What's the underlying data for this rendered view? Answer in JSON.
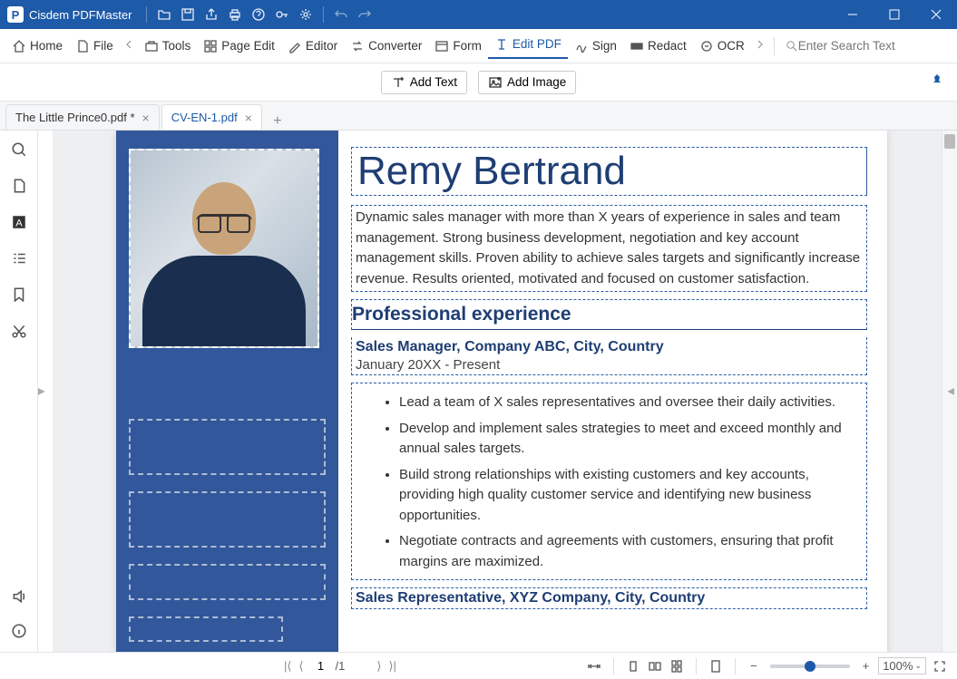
{
  "app": {
    "name": "Cisdem PDFMaster"
  },
  "mainToolbar": {
    "home": "Home",
    "file": "File",
    "tools": "Tools",
    "pageEdit": "Page Edit",
    "editor": "Editor",
    "converter": "Converter",
    "form": "Form",
    "editPdf": "Edit PDF",
    "sign": "Sign",
    "redact": "Redact",
    "ocr": "OCR",
    "searchPlaceholder": "Enter Search Text"
  },
  "editToolbar": {
    "addText": "Add Text",
    "addImage": "Add Image"
  },
  "tabs": [
    {
      "label": "The Little Prince0.pdf *",
      "active": false
    },
    {
      "label": "CV-EN-1.pdf",
      "active": true
    }
  ],
  "doc": {
    "name": "Remy Bertrand",
    "summary": "Dynamic sales manager with more than X years of experience in sales and team management. Strong business development, negotiation and key account management skills. Proven ability to achieve sales targets and significantly increase revenue. Results oriented, motivated and focused on customer satisfaction.",
    "section1": "Professional experience",
    "job1_title": "Sales Manager, Company ABC, City, Country",
    "job1_date": "January 20XX - Present",
    "bullets": [
      "Lead a team of X sales representatives and oversee their daily activities.",
      "Develop and implement sales strategies to meet and exceed monthly and annual sales targets.",
      "Build strong relationships with existing customers and key accounts, providing high quality customer service and identifying new business opportunities.",
      "Negotiate contracts and agreements with customers, ensuring that profit margins are maximized."
    ],
    "job2_title": "Sales Representative, XYZ Company, City, Country"
  },
  "statusbar": {
    "page": "1",
    "total": "/1",
    "zoom": "100%"
  }
}
